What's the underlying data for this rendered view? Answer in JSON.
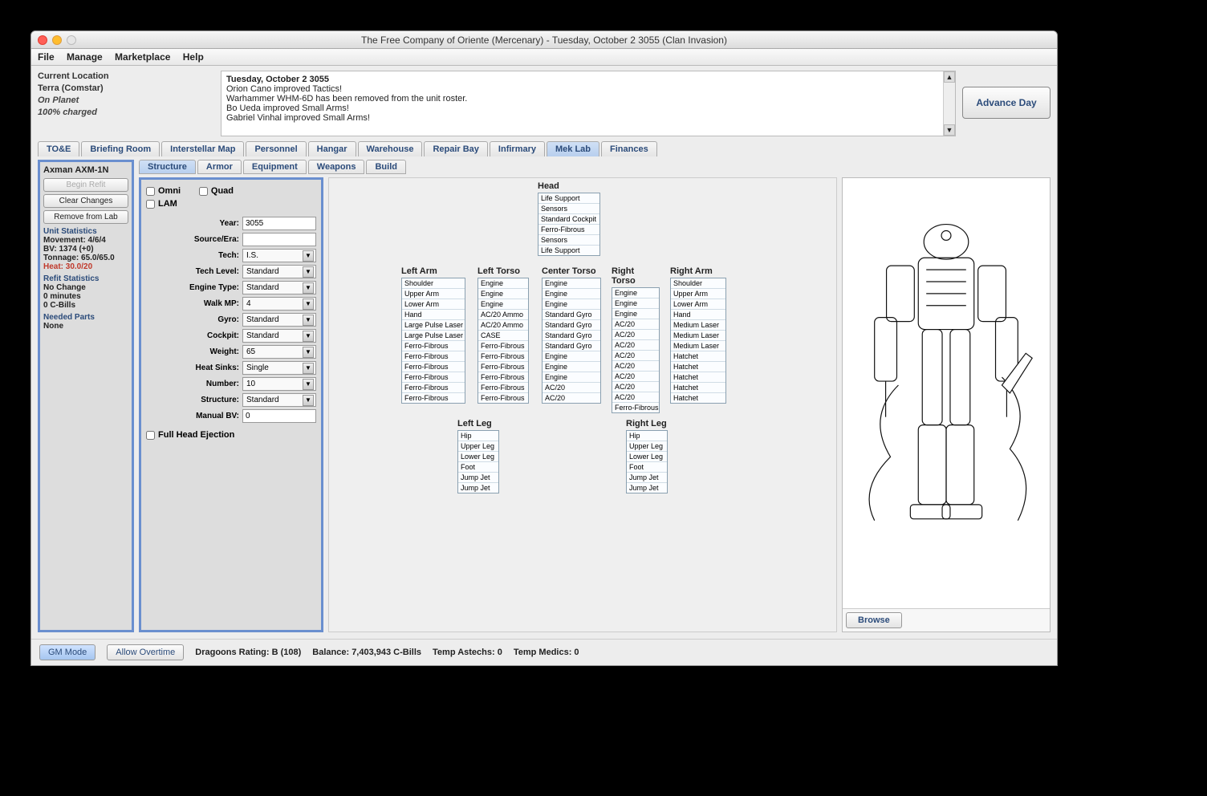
{
  "window": {
    "title": "The Free Company of Oriente (Mercenary) - Tuesday, October 2 3055 (Clan Invasion)"
  },
  "menu": {
    "file": "File",
    "manage": "Manage",
    "marketplace": "Marketplace",
    "help": "Help"
  },
  "location": {
    "header": "Current Location",
    "loc": "Terra (Comstar)",
    "status": "On Planet",
    "charge": "100% charged"
  },
  "log": {
    "date": "Tuesday, October 2 3055",
    "l1": "Orion Cano improved Tactics!",
    "l2": "Warhammer WHM-6D has been removed from the unit roster.",
    "l3": "Bo Ueda improved Small Arms!",
    "l4": "Gabriel Vinhal improved Small Arms!"
  },
  "advance": "Advance Day",
  "main_tabs": {
    "toe": "TO&E",
    "brief": "Briefing Room",
    "map": "Interstellar Map",
    "pers": "Personnel",
    "hangar": "Hangar",
    "ware": "Warehouse",
    "repair": "Repair Bay",
    "inf": "Infirmary",
    "mek": "Mek Lab",
    "fin": "Finances"
  },
  "unit_name": "Axman AXM-1N",
  "left_buttons": {
    "begin": "Begin Refit",
    "clear": "Clear Changes",
    "remove": "Remove from Lab"
  },
  "unit_stats": {
    "header": "Unit Statistics",
    "move": "Movement: 4/6/4",
    "bv": "BV: 1374 (+0)",
    "ton": "Tonnage: 65.0/65.0",
    "heat": "Heat: 30.0/20"
  },
  "refit": {
    "header": "Refit Statistics",
    "nochange": "No Change",
    "time": "0 minutes",
    "cost": "0 C-Bills"
  },
  "needed": {
    "header": "Needed Parts",
    "none": "None"
  },
  "sub_tabs": {
    "struct": "Structure",
    "armor": "Armor",
    "equip": "Equipment",
    "weap": "Weapons",
    "build": "Build"
  },
  "chk": {
    "omni": "Omni",
    "quad": "Quad",
    "lam": "LAM",
    "fhe": "Full Head Ejection"
  },
  "form": {
    "year_l": "Year:",
    "year": "3055",
    "src_l": "Source/Era:",
    "src": "",
    "tech_l": "Tech:",
    "tech": "I.S.",
    "tlvl_l": "Tech Level:",
    "tlvl": "Standard",
    "eng_l": "Engine Type:",
    "eng": "Standard",
    "walk_l": "Walk MP:",
    "walk": "4",
    "gyro_l": "Gyro:",
    "gyro": "Standard",
    "cock_l": "Cockpit:",
    "cock": "Standard",
    "wt_l": "Weight:",
    "wt": "65",
    "hs_l": "Heat Sinks:",
    "hs": "Single",
    "num_l": "Number:",
    "num": "10",
    "str_l": "Structure:",
    "str": "Standard",
    "mbv_l": "Manual BV:",
    "mbv": "0"
  },
  "loc": {
    "head": "Head",
    "la": "Left Arm",
    "lt": "Left Torso",
    "ct": "Center Torso",
    "rt": "Right Torso",
    "ra": "Right Arm",
    "ll": "Left Leg",
    "rl": "Right Leg"
  },
  "slots": {
    "head": [
      "Life Support",
      "Sensors",
      "Standard Cockpit",
      "Ferro-Fibrous",
      "Sensors",
      "Life Support"
    ],
    "la": [
      "Shoulder",
      "Upper Arm",
      "Lower Arm",
      "Hand",
      "Large Pulse Laser",
      "Large Pulse Laser",
      "Ferro-Fibrous",
      "Ferro-Fibrous",
      "Ferro-Fibrous",
      "Ferro-Fibrous",
      "Ferro-Fibrous",
      "Ferro-Fibrous"
    ],
    "lt": [
      "Engine",
      "Engine",
      "Engine",
      "AC/20 Ammo",
      "AC/20 Ammo",
      "CASE",
      "Ferro-Fibrous",
      "Ferro-Fibrous",
      "Ferro-Fibrous",
      "Ferro-Fibrous",
      "Ferro-Fibrous",
      "Ferro-Fibrous"
    ],
    "ct": [
      "Engine",
      "Engine",
      "Engine",
      "Standard Gyro",
      "Standard Gyro",
      "Standard Gyro",
      "Standard Gyro",
      "Engine",
      "Engine",
      "Engine",
      "AC/20",
      "AC/20"
    ],
    "rt": [
      "Engine",
      "Engine",
      "Engine",
      "AC/20",
      "AC/20",
      "AC/20",
      "AC/20",
      "AC/20",
      "AC/20",
      "AC/20",
      "AC/20",
      "Ferro-Fibrous"
    ],
    "ra": [
      "Shoulder",
      "Upper Arm",
      "Lower Arm",
      "Hand",
      "Medium Laser",
      "Medium Laser",
      "Medium Laser",
      "Hatchet",
      "Hatchet",
      "Hatchet",
      "Hatchet",
      "Hatchet"
    ],
    "ll": [
      "Hip",
      "Upper Leg",
      "Lower Leg",
      "Foot",
      "Jump Jet",
      "Jump Jet"
    ],
    "rl": [
      "Hip",
      "Upper Leg",
      "Lower Leg",
      "Foot",
      "Jump Jet",
      "Jump Jet"
    ]
  },
  "browse": "Browse",
  "status": {
    "gm": "GM Mode",
    "ot": "Allow Overtime",
    "drag": "Dragoons Rating: B (108)",
    "bal": "Balance: 7,403,943 C-Bills",
    "ast": "Temp Astechs: 0",
    "med": "Temp Medics: 0"
  }
}
